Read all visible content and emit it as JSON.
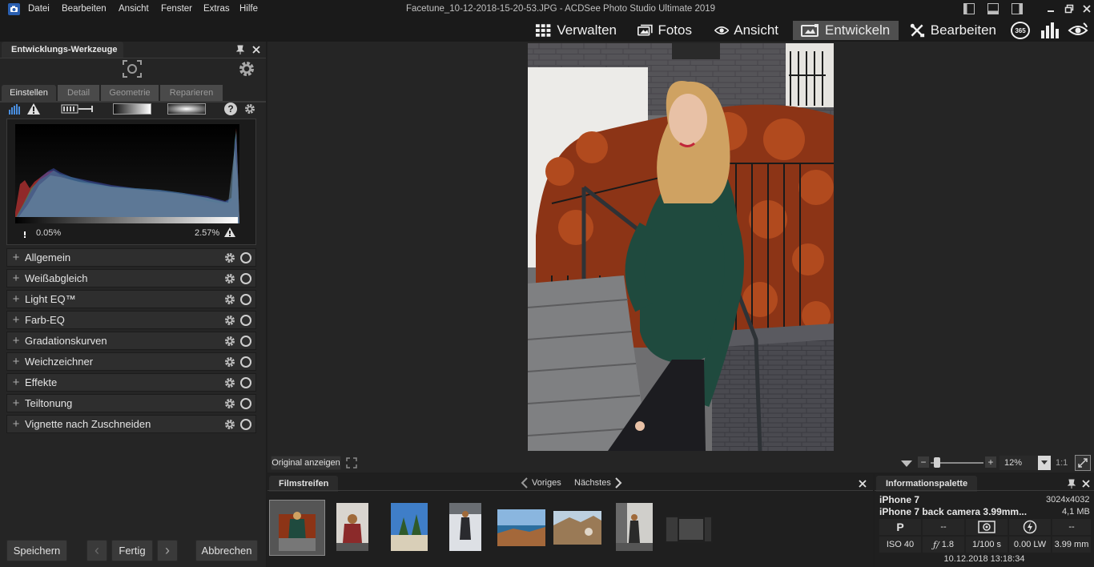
{
  "window": {
    "title": "Facetune_10-12-2018-15-20-53.JPG - ACDSee Photo Studio Ultimate 2019",
    "menu": [
      "Datei",
      "Bearbeiten",
      "Ansicht",
      "Fenster",
      "Extras",
      "Hilfe"
    ]
  },
  "modes": {
    "manage": "Verwalten",
    "photos": "Fotos",
    "view": "Ansicht",
    "develop": "Entwickeln",
    "edit": "Bearbeiten",
    "badge365": "365"
  },
  "left_panel": {
    "title": "Entwicklungs-Werkzeuge",
    "tabs": [
      "Einstellen",
      "Detail",
      "Geometrie",
      "Reparieren"
    ],
    "histogram": {
      "clip_low": "0.05%",
      "clip_high": "2.57%"
    },
    "sections": [
      "Allgemein",
      "Weißabgleich",
      "Light EQ™",
      "Farb-EQ",
      "Gradationskurven",
      "Weichzeichner",
      "Effekte",
      "Teiltonung",
      "Vignette nach Zuschneiden"
    ],
    "buttons": {
      "save": "Speichern",
      "done": "Fertig",
      "cancel": "Abbrechen"
    }
  },
  "viewer": {
    "show_original": "Original anzeigen",
    "zoom": "12%",
    "ratio": "1:1"
  },
  "filmstrip": {
    "title": "Filmstreifen",
    "prev": "Voriges",
    "next": "Nächstes"
  },
  "info": {
    "title": "Informationspalette",
    "camera": "iPhone 7",
    "resolution": "3024x4032",
    "lens": "iPhone 7 back camera 3.99mm...",
    "filesize": "4,1 MB",
    "mode": "P",
    "dash1": "--",
    "dash2": "--",
    "iso": "ISO 40",
    "aperture": "1.8",
    "shutter": "1/100 s",
    "ev": "0.00 LW",
    "focal": "3.99 mm",
    "datetime": "10.12.2018 13:18:34"
  },
  "colors": {
    "panel_bg": "#252525",
    "active_mode_bg": "#4f4f4f",
    "histogram_bg": "#0c0c0c"
  }
}
